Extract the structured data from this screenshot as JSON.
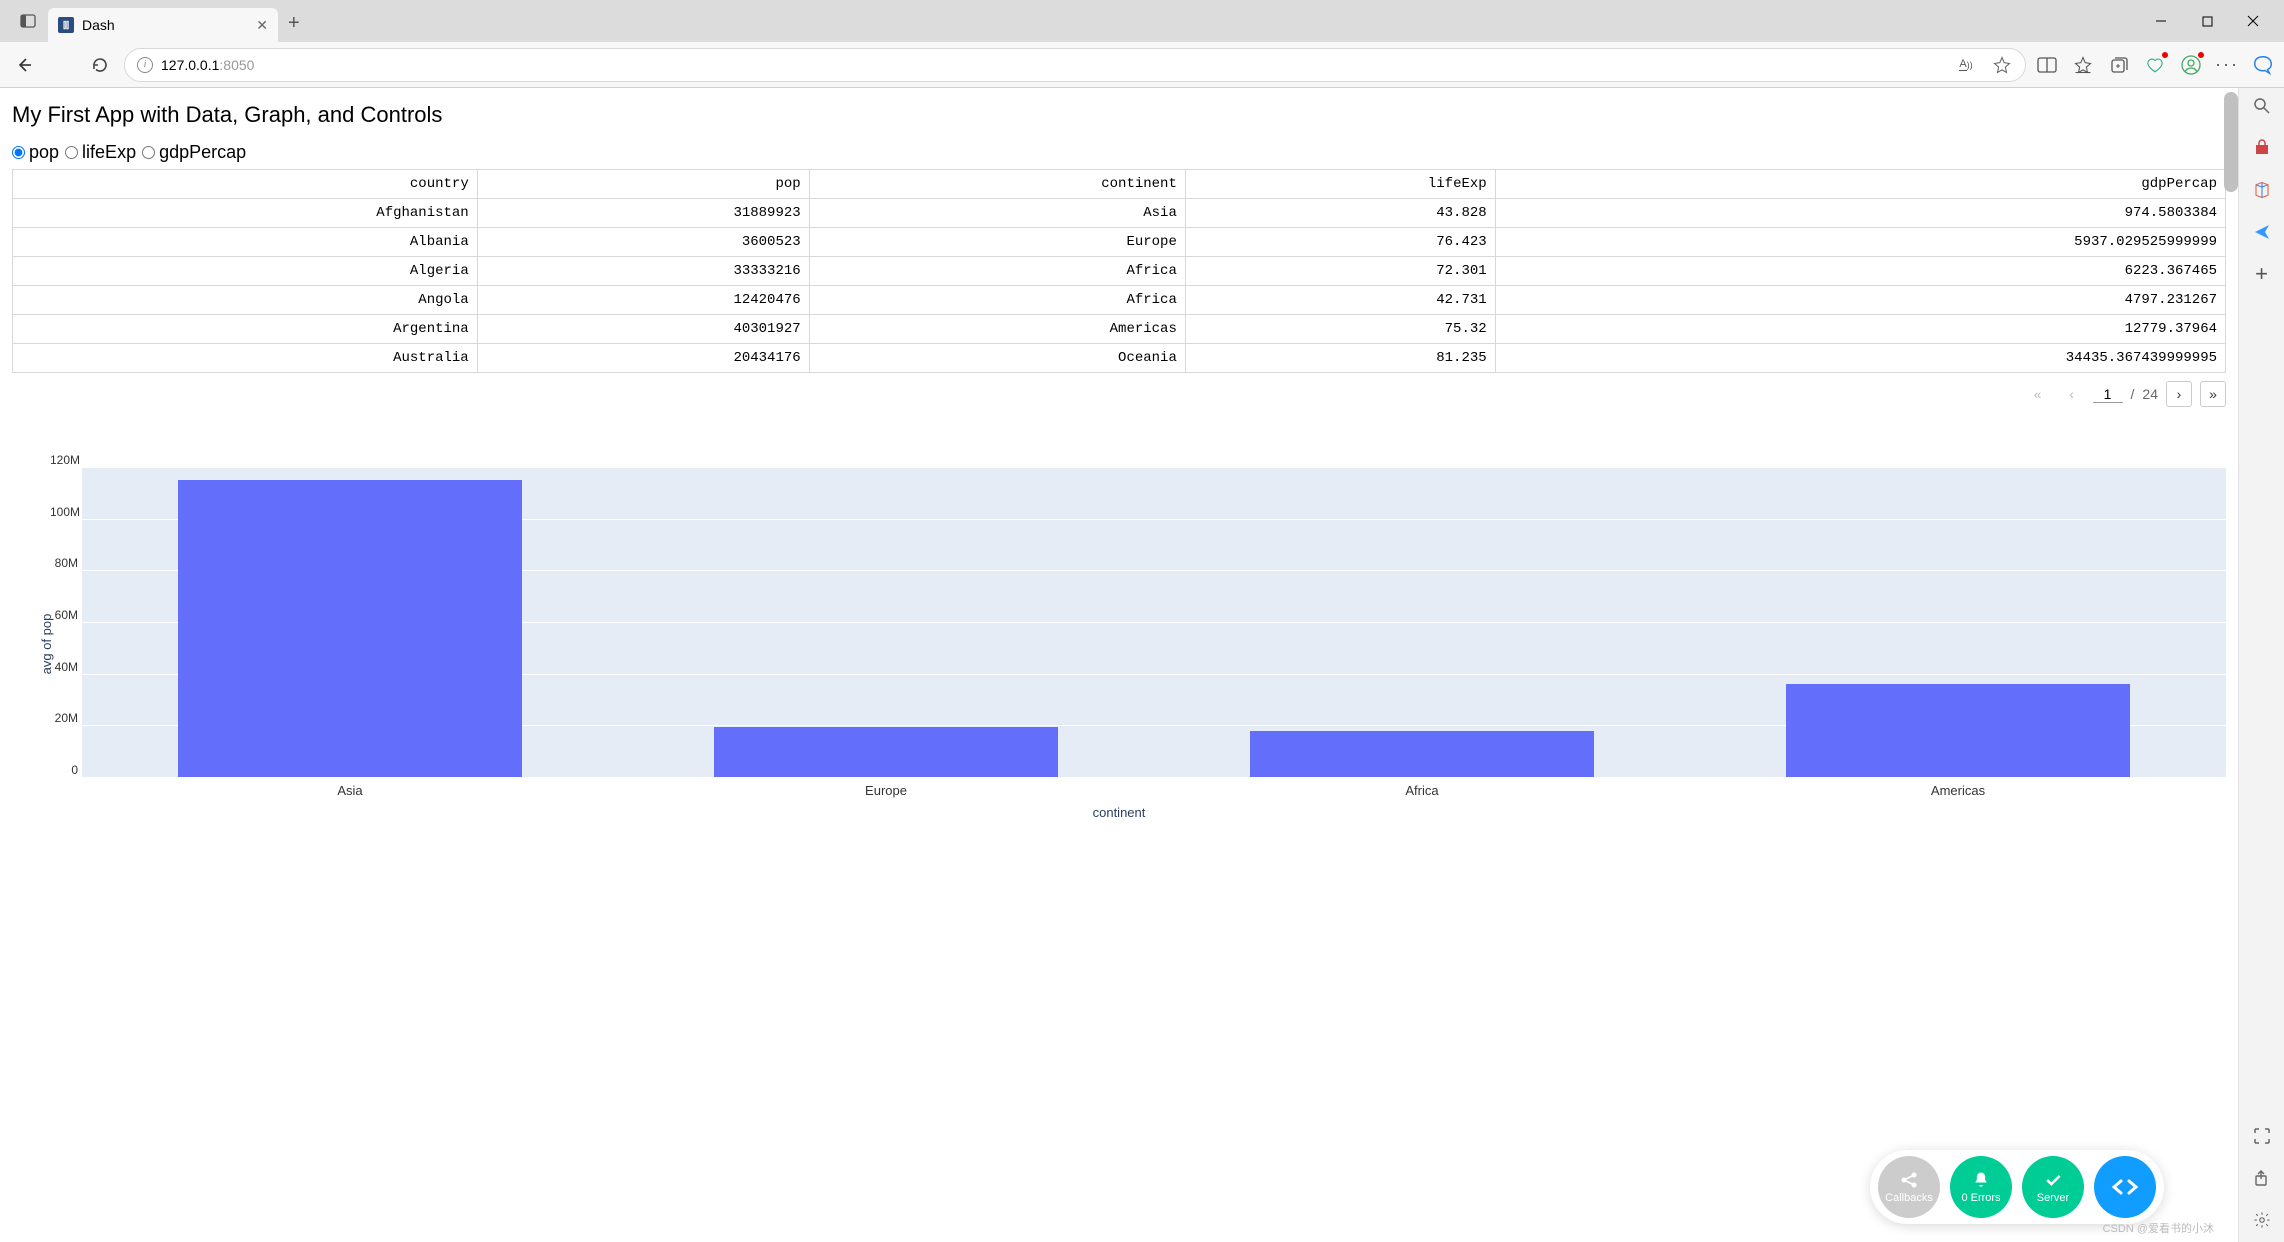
{
  "browser": {
    "tab_title": "Dash",
    "url_host": "127.0.0.1",
    "url_port": ":8050",
    "font_size_indicator": "A"
  },
  "app": {
    "title": "My First App with Data, Graph, and Controls"
  },
  "radio": {
    "options": [
      {
        "label": "pop",
        "selected": true
      },
      {
        "label": "lifeExp",
        "selected": false
      },
      {
        "label": "gdpPercap",
        "selected": false
      }
    ]
  },
  "table": {
    "headers": [
      "country",
      "pop",
      "continent",
      "lifeExp",
      "gdpPercap"
    ],
    "rows": [
      [
        "Afghanistan",
        "31889923",
        "Asia",
        "43.828",
        "974.5803384"
      ],
      [
        "Albania",
        "3600523",
        "Europe",
        "76.423",
        "5937.029525999999"
      ],
      [
        "Algeria",
        "33333216",
        "Africa",
        "72.301",
        "6223.367465"
      ],
      [
        "Angola",
        "12420476",
        "Africa",
        "42.731",
        "4797.231267"
      ],
      [
        "Argentina",
        "40301927",
        "Americas",
        "75.32",
        "12779.37964"
      ],
      [
        "Australia",
        "20434176",
        "Oceania",
        "81.235",
        "34435.367439999995"
      ]
    ]
  },
  "pagination": {
    "current": "1",
    "sep": "/",
    "total": "24"
  },
  "chart_data": {
    "type": "bar",
    "xlabel": "continent",
    "ylabel": "avg of pop",
    "ylim": [
      0,
      120000000
    ],
    "yticks": [
      {
        "v": 0,
        "label": "0"
      },
      {
        "v": 20000000,
        "label": "20M"
      },
      {
        "v": 40000000,
        "label": "40M"
      },
      {
        "v": 60000000,
        "label": "60M"
      },
      {
        "v": 80000000,
        "label": "80M"
      },
      {
        "v": 100000000,
        "label": "100M"
      },
      {
        "v": 120000000,
        "label": "120M"
      }
    ],
    "categories": [
      "Asia",
      "Europe",
      "Africa",
      "Americas"
    ],
    "values": [
      115000000,
      19500000,
      18000000,
      36000000
    ],
    "bar_color": "#636efa",
    "plot_bg": "#e5ecf6"
  },
  "devtools": {
    "callbacks": "Callbacks",
    "errors": "0 Errors",
    "server": "Server"
  },
  "watermark": "CSDN @爱看书的小沐"
}
